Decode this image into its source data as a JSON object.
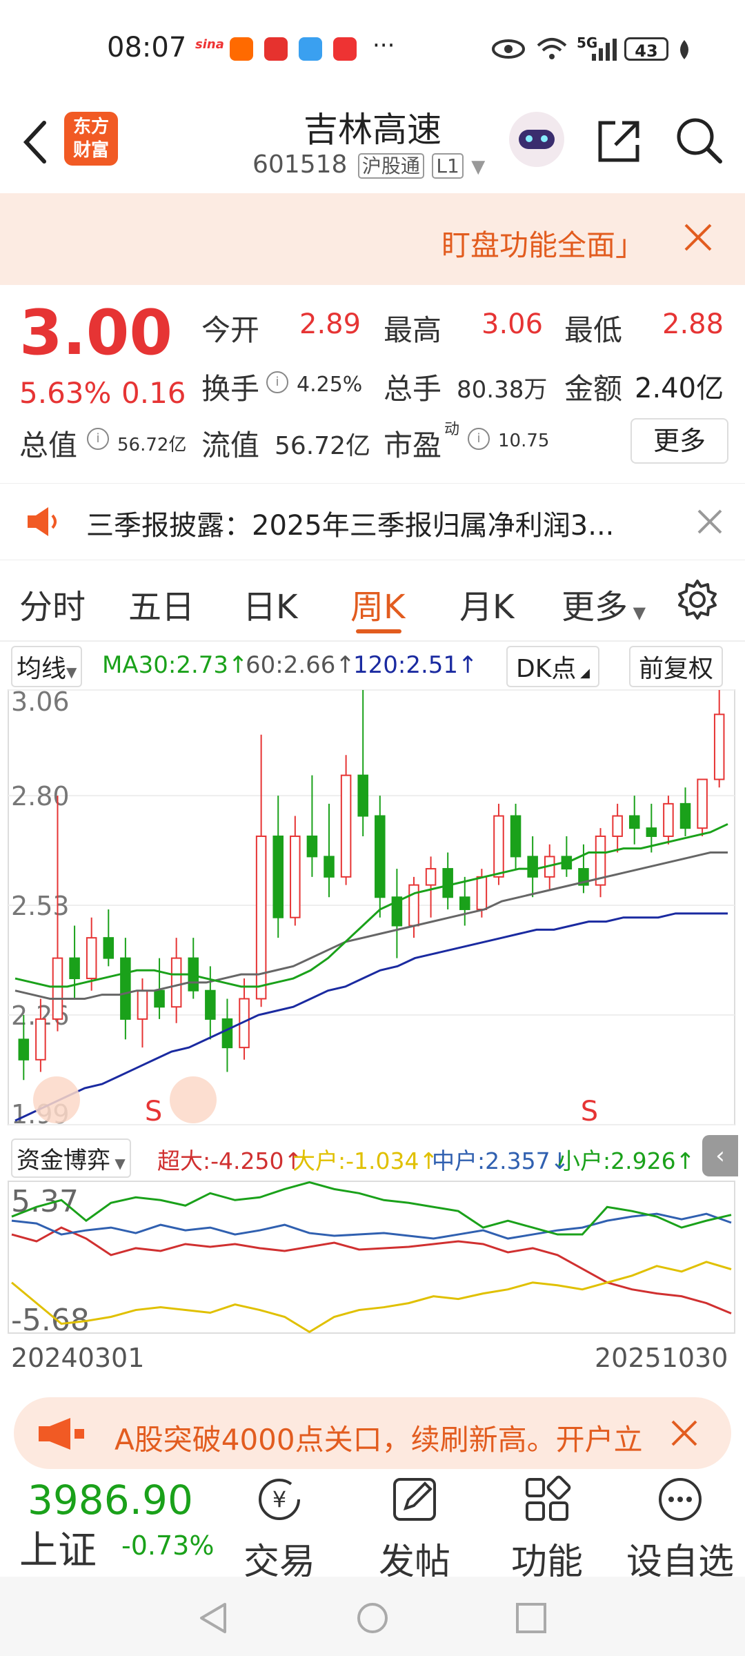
{
  "status_bar": {
    "time": "08:07",
    "battery": "43",
    "network": "5G",
    "more": "···"
  },
  "header": {
    "title": "吉林高速",
    "code": "601518",
    "tag_market": "沪股通",
    "tag_level": "L1",
    "logo_line1": "东方",
    "logo_line2": "财富"
  },
  "banner": {
    "text": "盯盘功能全面」"
  },
  "quote": {
    "price": "3.00",
    "change_pct": "5.63%",
    "change": "0.16",
    "open_label": "今开",
    "open": "2.89",
    "high_label": "最高",
    "high": "3.06",
    "low_label": "最低",
    "low": "2.88",
    "turnover_label": "换手",
    "turnover": "4.25%",
    "volume_label": "总手",
    "volume": "80.38万",
    "amount_label": "金额",
    "amount": "2.40亿",
    "mktcap_label": "总值",
    "mktcap": "56.72亿",
    "float_label": "流值",
    "float": "56.72亿",
    "pe_label": "市盈",
    "pe_sup": "动",
    "pe": "10.75",
    "more_label": "更多"
  },
  "notice": {
    "text": "三季报披露：2025年三季报归属净利润3..."
  },
  "tabs": [
    "分时",
    "五日",
    "日K",
    "周K",
    "月K",
    "更多"
  ],
  "active_tab": "周K",
  "chart_header": {
    "ma_select": "均线",
    "ma30": "MA30:2.73↑",
    "ma60": "60:2.66↑",
    "ma120": "120:2.51↑",
    "dk": "DK点",
    "adjust": "前复权"
  },
  "colors": {
    "up": "#e63434",
    "down": "#1aa11a",
    "accent": "#e25c1f",
    "ma30": "#1aa11a",
    "ma60": "#666666",
    "ma120": "#1a2aa0"
  },
  "chart_data": [
    {
      "type": "candlestick",
      "y_ticks": [
        "3.06",
        "2.80",
        "2.53",
        "2.26",
        "1.99"
      ],
      "ylim": [
        1.99,
        3.06
      ],
      "markers": [
        "S",
        "S"
      ],
      "ma30": [
        2.35,
        2.34,
        2.33,
        2.33,
        2.34,
        2.35,
        2.36,
        2.37,
        2.37,
        2.36,
        2.36,
        2.35,
        2.34,
        2.33,
        2.33,
        2.34,
        2.35,
        2.37,
        2.4,
        2.44,
        2.48,
        2.52,
        2.54,
        2.56,
        2.57,
        2.58,
        2.59,
        2.6,
        2.61,
        2.62,
        2.62,
        2.63,
        2.64,
        2.66,
        2.66,
        2.67,
        2.67,
        2.68,
        2.69,
        2.7,
        2.71,
        2.73
      ],
      "ma60": [
        2.32,
        2.31,
        2.3,
        2.3,
        2.3,
        2.31,
        2.31,
        2.32,
        2.32,
        2.33,
        2.34,
        2.34,
        2.35,
        2.36,
        2.36,
        2.37,
        2.38,
        2.4,
        2.42,
        2.44,
        2.45,
        2.46,
        2.47,
        2.48,
        2.49,
        2.5,
        2.51,
        2.52,
        2.54,
        2.55,
        2.56,
        2.57,
        2.58,
        2.59,
        2.6,
        2.61,
        2.62,
        2.63,
        2.64,
        2.65,
        2.66,
        2.66
      ],
      "ma120": [
        2.0,
        2.02,
        2.04,
        2.06,
        2.08,
        2.09,
        2.11,
        2.13,
        2.15,
        2.17,
        2.18,
        2.2,
        2.22,
        2.24,
        2.26,
        2.27,
        2.28,
        2.3,
        2.32,
        2.33,
        2.35,
        2.37,
        2.38,
        2.4,
        2.41,
        2.42,
        2.43,
        2.44,
        2.45,
        2.46,
        2.47,
        2.47,
        2.48,
        2.49,
        2.49,
        2.5,
        2.5,
        2.5,
        2.51,
        2.51,
        2.51,
        2.51
      ],
      "candles": [
        [
          2.2,
          2.26,
          2.1,
          2.15
        ],
        [
          2.15,
          2.3,
          2.12,
          2.25
        ],
        [
          2.25,
          2.8,
          2.22,
          2.4
        ],
        [
          2.4,
          2.48,
          2.3,
          2.35
        ],
        [
          2.35,
          2.5,
          2.32,
          2.45
        ],
        [
          2.45,
          2.52,
          2.38,
          2.4
        ],
        [
          2.4,
          2.45,
          2.2,
          2.25
        ],
        [
          2.25,
          2.35,
          2.18,
          2.32
        ],
        [
          2.32,
          2.4,
          2.25,
          2.28
        ],
        [
          2.28,
          2.45,
          2.24,
          2.4
        ],
        [
          2.4,
          2.45,
          2.3,
          2.32
        ],
        [
          2.32,
          2.38,
          2.2,
          2.25
        ],
        [
          2.25,
          2.3,
          2.12,
          2.18
        ],
        [
          2.18,
          2.35,
          2.15,
          2.3
        ],
        [
          2.3,
          2.95,
          2.28,
          2.7
        ],
        [
          2.7,
          2.8,
          2.45,
          2.5
        ],
        [
          2.5,
          2.75,
          2.48,
          2.7
        ],
        [
          2.7,
          2.85,
          2.6,
          2.65
        ],
        [
          2.65,
          2.78,
          2.55,
          2.6
        ],
        [
          2.6,
          2.9,
          2.58,
          2.85
        ],
        [
          2.85,
          3.06,
          2.7,
          2.75
        ],
        [
          2.75,
          2.8,
          2.5,
          2.55
        ],
        [
          2.55,
          2.62,
          2.4,
          2.48
        ],
        [
          2.48,
          2.6,
          2.45,
          2.58
        ],
        [
          2.58,
          2.65,
          2.5,
          2.62
        ],
        [
          2.62,
          2.66,
          2.52,
          2.55
        ],
        [
          2.55,
          2.6,
          2.48,
          2.52
        ],
        [
          2.52,
          2.62,
          2.5,
          2.6
        ],
        [
          2.6,
          2.78,
          2.58,
          2.75
        ],
        [
          2.75,
          2.78,
          2.62,
          2.65
        ],
        [
          2.65,
          2.7,
          2.55,
          2.6
        ],
        [
          2.6,
          2.68,
          2.57,
          2.65
        ],
        [
          2.65,
          2.7,
          2.6,
          2.62
        ],
        [
          2.62,
          2.68,
          2.56,
          2.58
        ],
        [
          2.58,
          2.72,
          2.55,
          2.7
        ],
        [
          2.7,
          2.78,
          2.66,
          2.75
        ],
        [
          2.75,
          2.8,
          2.68,
          2.72
        ],
        [
          2.72,
          2.78,
          2.66,
          2.7
        ],
        [
          2.7,
          2.8,
          2.68,
          2.78
        ],
        [
          2.78,
          2.82,
          2.7,
          2.72
        ],
        [
          2.72,
          2.8,
          2.7,
          2.84
        ],
        [
          2.84,
          3.06,
          2.82,
          3.0
        ]
      ]
    },
    {
      "type": "line",
      "title": "资金博弈",
      "y_ticks": [
        "5.37",
        "-5.68"
      ],
      "ylim": [
        -5.68,
        5.37
      ],
      "x_start": "20240301",
      "x_end": "20251030",
      "series": [
        {
          "name": "超大",
          "value_label": "超大:-4.250↑",
          "color": "#d03030",
          "values": [
            1.5,
            1.0,
            2.0,
            1.2,
            0.0,
            0.5,
            0.3,
            0.8,
            0.6,
            0.8,
            0.5,
            0.3,
            0.6,
            0.9,
            0.4,
            0.5,
            0.6,
            0.8,
            1.0,
            0.8,
            0.2,
            0.5,
            0.0,
            -1.0,
            -2.0,
            -2.5,
            -2.8,
            -3.0,
            -3.5,
            -4.25
          ]
        },
        {
          "name": "大户",
          "value_label": "大户:-1.034↑",
          "color": "#e0c000",
          "values": [
            -2.0,
            -3.5,
            -5.0,
            -4.8,
            -4.5,
            -4.0,
            -3.8,
            -4.0,
            -4.2,
            -3.6,
            -4.0,
            -4.5,
            -5.6,
            -4.5,
            -4.0,
            -3.8,
            -3.5,
            -3.0,
            -3.2,
            -2.8,
            -2.5,
            -2.0,
            -2.2,
            -2.5,
            -2.0,
            -1.5,
            -0.8,
            -1.2,
            -0.5,
            -1.034
          ]
        },
        {
          "name": "中户",
          "value_label": "中户:2.357↓",
          "color": "#3060b0",
          "values": [
            2.5,
            2.3,
            1.5,
            1.8,
            2.0,
            1.6,
            2.2,
            1.8,
            2.0,
            1.5,
            1.8,
            2.2,
            1.6,
            1.4,
            1.5,
            1.6,
            1.4,
            1.2,
            1.5,
            1.8,
            1.2,
            1.5,
            1.8,
            2.0,
            2.5,
            2.8,
            3.0,
            2.6,
            3.0,
            2.357
          ]
        },
        {
          "name": "小户",
          "value_label": "小户:2.926↑",
          "color": "#1aa11a",
          "values": [
            2.8,
            3.5,
            4.0,
            2.5,
            3.8,
            4.2,
            4.0,
            3.6,
            4.5,
            4.0,
            4.2,
            4.8,
            5.3,
            4.8,
            4.5,
            4.0,
            3.8,
            3.5,
            3.2,
            2.0,
            2.5,
            2.0,
            1.5,
            1.5,
            3.5,
            3.2,
            2.8,
            2.0,
            2.5,
            2.926
          ]
        }
      ]
    }
  ],
  "footer_banner": {
    "text": "A股突破4000点关口，续刷新高。开户立"
  },
  "bottom_bar": {
    "index_value": "3986.90",
    "index_name": "上证",
    "index_change": "-0.73%",
    "trade": "交易",
    "post": "发帖",
    "function": "功能",
    "watch": "设自选"
  }
}
